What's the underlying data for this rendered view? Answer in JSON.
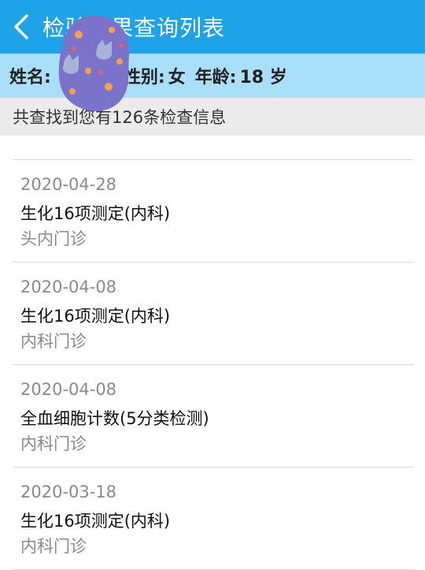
{
  "header": {
    "title": "检验结果查询列表"
  },
  "patient": {
    "name_label": "姓名:",
    "gender_label": "性别:",
    "gender": "女",
    "age_label": "年龄:",
    "age": "18 岁"
  },
  "summary": {
    "text": "共查找到您有126条检查信息"
  },
  "records": [
    {
      "date": "2020-04-28",
      "name": "生化16项测定(内科)",
      "dept": "头内门诊"
    },
    {
      "date": "2020-04-08",
      "name": "生化16项测定(内科)",
      "dept": "内科门诊"
    },
    {
      "date": "2020-04-08",
      "name": "全血细胞计数(5分类检测)",
      "dept": "内科门诊"
    },
    {
      "date": "2020-03-18",
      "name": "生化16项测定(内科)",
      "dept": "内科门诊"
    }
  ],
  "colors": {
    "header": "#1ea2e8",
    "info_bar": "#a9dff8",
    "summary_bg": "#ebebeb",
    "sticker": "#7b72c9"
  }
}
